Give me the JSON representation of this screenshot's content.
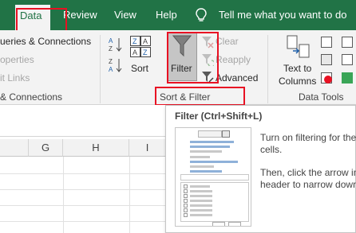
{
  "tabs": [
    "Data",
    "Review",
    "View",
    "Help"
  ],
  "tellme": "Tell me what you want to do",
  "ribbon": {
    "queries": [
      "ueries & Connections",
      "operties",
      "it Links"
    ],
    "queries_group": "& Connections",
    "sort_label": "Sort",
    "filter_label": "Filter",
    "clear_label": "Clear",
    "reapply_label": "Reapply",
    "advanced_label": "Advanced",
    "sort_filter_group": "Sort & Filter",
    "text_to_columns_1": "Text to",
    "text_to_columns_2": "Columns",
    "data_tools_group": "Data Tools"
  },
  "columns": [
    "G",
    "H",
    "I"
  ],
  "tooltip": {
    "title": "Filter (Ctrl+Shift+L)",
    "text1a": "Turn on filtering for the",
    "text1b": "cells.",
    "text2a": "Then, click the arrow in",
    "text2b": "header to narrow down"
  },
  "colors": {
    "accent": "#217346",
    "highlight": "#e81123"
  },
  "icons": [
    "sort-az-icon",
    "sort-za-icon",
    "sort-icon",
    "filter-funnel-icon",
    "clear-filter-icon",
    "reapply-icon",
    "advanced-filter-icon",
    "text-to-columns-icon",
    "lightbulb-icon"
  ]
}
